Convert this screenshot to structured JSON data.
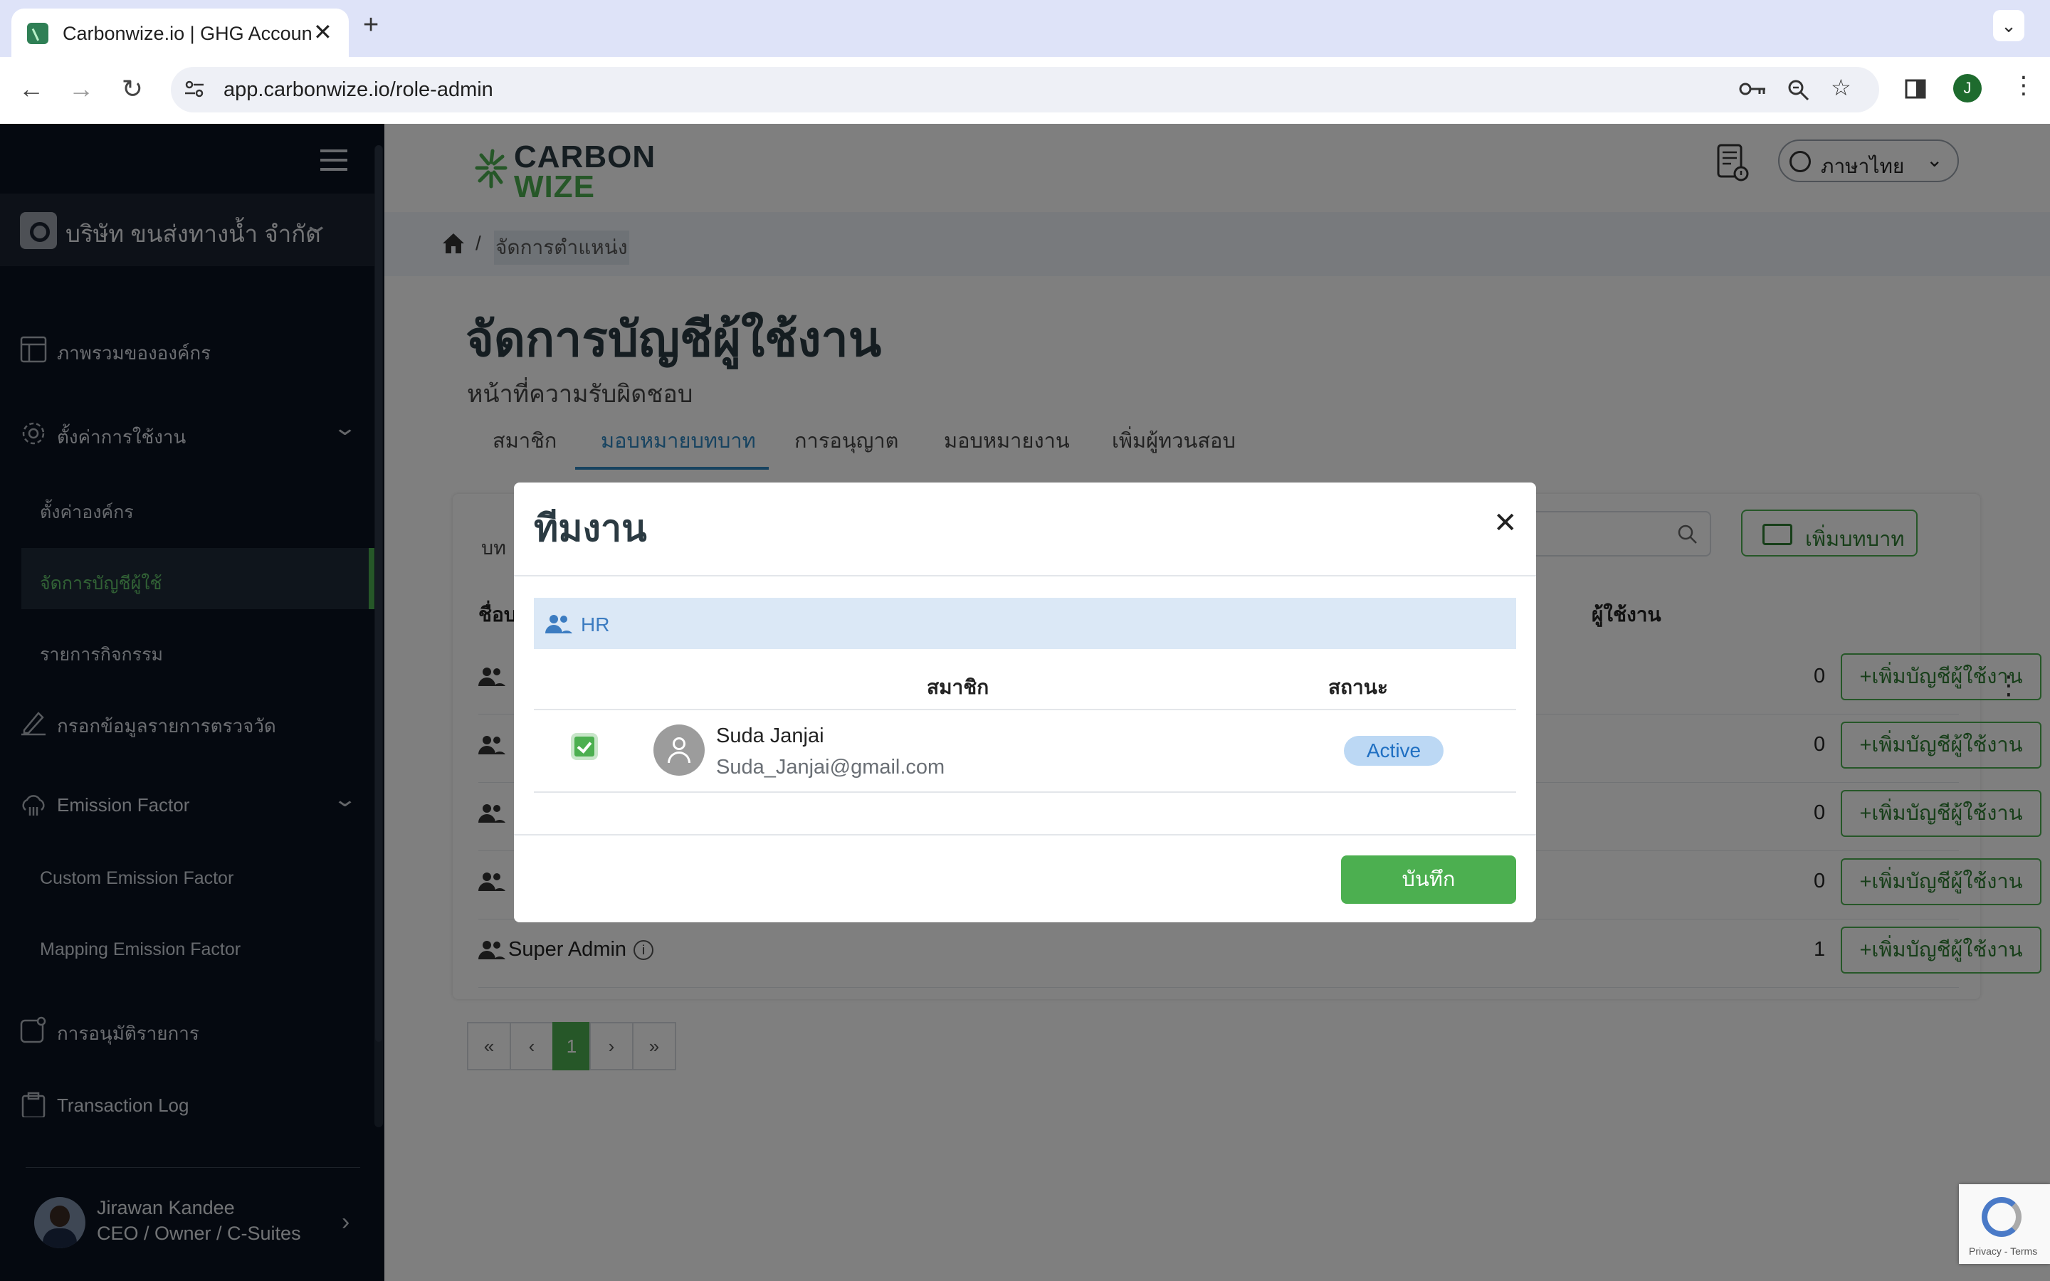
{
  "browser": {
    "tab_title": "Carbonwize.io | GHG Accounting",
    "new_tab": "+",
    "url": "app.carbonwize.io/role-admin"
  },
  "sidebar": {
    "org_name": "บริษัท ขนส่งทางน้ำ จำกัด",
    "items": [
      {
        "label": "ภาพรวมขององค์กร",
        "icon": "dashboard-icon"
      },
      {
        "label": "ตั้งค่าการใช้งาน",
        "icon": "gear-icon"
      },
      {
        "label": "ตั้งค่าองค์กร"
      },
      {
        "label": "จัดการบัญชีผู้ใช้"
      },
      {
        "label": "รายการกิจกรรม"
      },
      {
        "label": "กรอกข้อมูลรายการตรวจวัด",
        "icon": "edit-icon"
      },
      {
        "label": "Emission Factor",
        "icon": "cloud-icon"
      },
      {
        "label": "Custom Emission Factor"
      },
      {
        "label": "Mapping Emission Factor"
      },
      {
        "label": "การอนุมัติรายการ",
        "icon": "approval-icon"
      },
      {
        "label": "Transaction Log",
        "icon": "clipboard-icon"
      }
    ],
    "user": {
      "name": "Jirawan Kandee",
      "role": "CEO / Owner / C-Suites"
    }
  },
  "header": {
    "logo_line1": "CARBON",
    "logo_line2": "WIZE",
    "language": "ภาษาไทย"
  },
  "breadcrumb": {
    "sep": "/",
    "current": "จัดการตำแหน่ง"
  },
  "page": {
    "title": "จัดการบัญชีผู้ใช้งาน",
    "subtitle": "หน้าที่ความรับผิดชอบ",
    "tabs": [
      "สมาชิก",
      "มอบหมายบทบาท",
      "การอนุญาต",
      "มอบหมายงาน",
      "เพิ่มผู้ทวนสอบ"
    ],
    "active_tab": 1
  },
  "table": {
    "filter_label": "บท",
    "add_role": "เพิ่มบทบาท",
    "header_name": "ชื่อบ",
    "header_users": "ผู้ใช้งาน",
    "add_user": "+เพิ่มบัญชีผู้ใช้งาน",
    "rows": [
      {
        "name": "",
        "count": "0"
      },
      {
        "name": "",
        "count": "0"
      },
      {
        "name": "",
        "count": "0"
      },
      {
        "name": "",
        "count": "0"
      },
      {
        "name": "Super Admin",
        "count": "1",
        "info": "i"
      }
    ]
  },
  "pager": {
    "first": "«",
    "prev": "‹",
    "page": "1",
    "next": "›",
    "last": "»"
  },
  "modal": {
    "title": "ทีมงาน",
    "close": "✕",
    "group": "HR",
    "col_member": "สมาชิก",
    "col_status": "สถานะ",
    "member": {
      "name": "Suda Janjai",
      "email": "Suda_Janjai@gmail.com",
      "status": "Active",
      "checked": true
    },
    "save": "บันทึก"
  },
  "recaptcha": {
    "text": "Privacy - Terms"
  },
  "colors": {
    "accent": "#4caf50",
    "primary_blue": "#2e86c1",
    "sidebar_bg": "#0b1220"
  }
}
